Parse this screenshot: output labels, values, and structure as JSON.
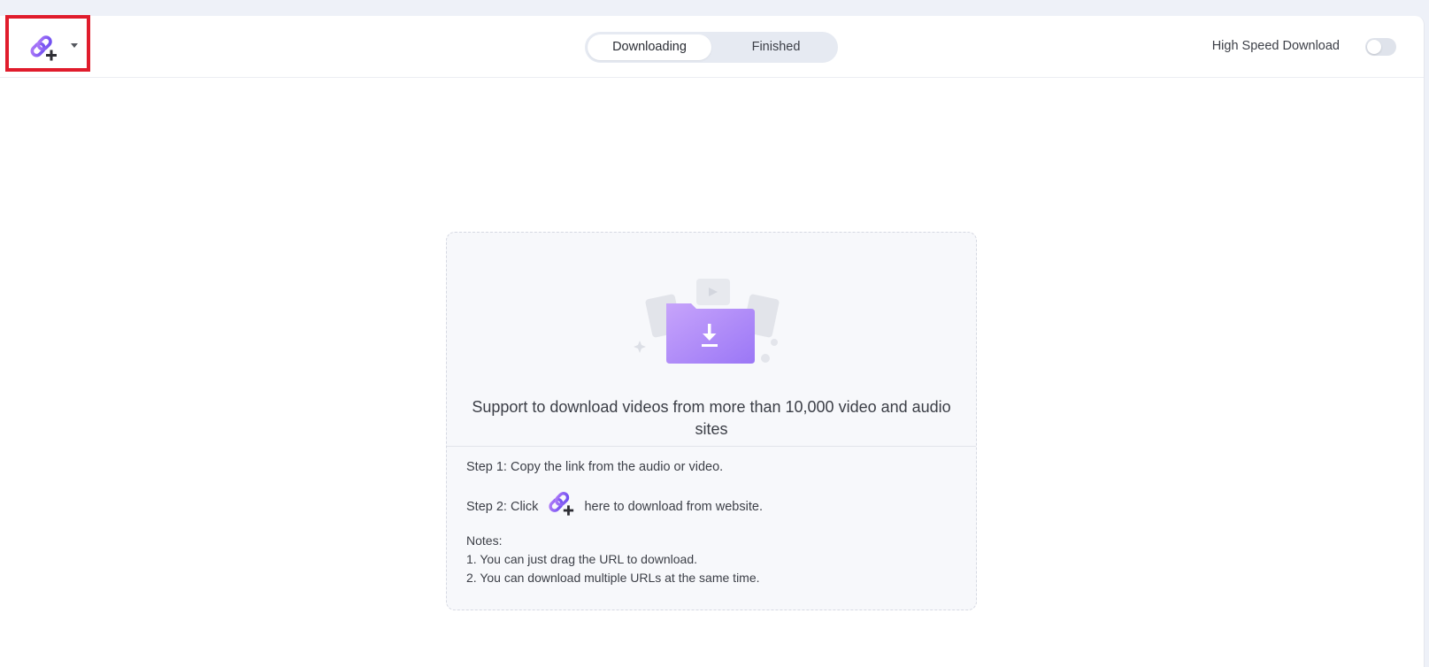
{
  "toolbar": {
    "add_url_icon": "link-plus-icon",
    "dropdown_icon": "caret-down-icon",
    "tabs": [
      {
        "label": "Downloading",
        "active": true
      },
      {
        "label": "Finished",
        "active": false
      }
    ],
    "high_speed_label": "High Speed Download",
    "high_speed_enabled": false
  },
  "empty_state": {
    "illustration_icon": "folder-download-icon",
    "headline": "Support to download videos from more than 10,000 video and audio sites",
    "step1": "Step 1: Copy the link from the audio or video.",
    "step2_prefix": "Step 2: Click",
    "step2_suffix": "here to download from website.",
    "notes_title": "Notes:",
    "notes": [
      "1. You can just drag the URL to download.",
      "2. You can download multiple URLs at the same time."
    ]
  },
  "colors": {
    "accent": "#8a5cf6",
    "highlight_border": "#e01c2c",
    "background": "#eef1f8"
  }
}
